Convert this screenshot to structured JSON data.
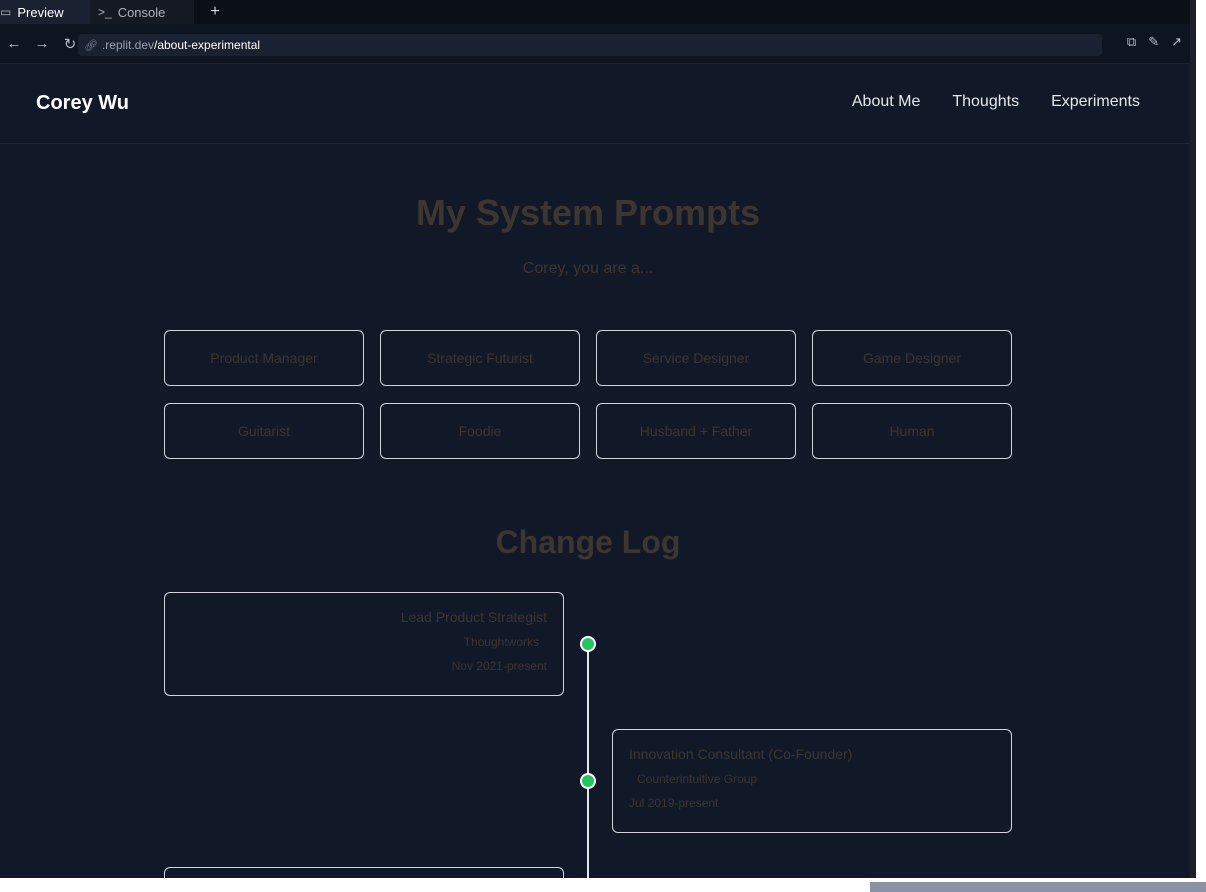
{
  "tabs": [
    {
      "label": "Preview",
      "icon": "monitor-icon"
    },
    {
      "label": "Console",
      "icon": "terminal-icon"
    }
  ],
  "add_tab_label": "+",
  "url": {
    "host": ".replit.dev",
    "path": "/about-experimental"
  },
  "site": {
    "brand": "Corey Wu",
    "nav": [
      "About Me",
      "Thoughts",
      "Experiments"
    ]
  },
  "main": {
    "title": "My System Prompts",
    "subtitle": "Corey, you are a...",
    "prompts": [
      "Product Manager",
      "Strategic Futurist",
      "Service Designer",
      "Game Designer",
      "Guitarist",
      "Foodie",
      "Husband + Father",
      "Human"
    ],
    "changelog_title": "Change Log",
    "changelog": [
      {
        "role": "Lead Product Strategist",
        "org": "Thoughtworks",
        "dates": "Nov 2021-present"
      },
      {
        "role": "Innovation Consultant (Co-Founder)",
        "org": "Counterintuitive Group",
        "dates": "Jul 2019-present"
      }
    ]
  },
  "colors": {
    "accent": "#22c55e",
    "background": "#111827",
    "muted_text": "#3d3630"
  }
}
